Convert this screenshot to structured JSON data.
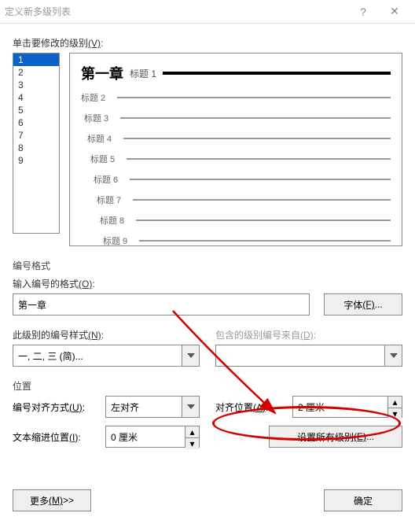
{
  "titlebar": {
    "title": "定义新多级列表",
    "help": "?",
    "close": "✕"
  },
  "labels": {
    "click_level": "单击要修改的级别",
    "click_level_key": "(V)",
    "number_format_section": "编号格式",
    "enter_format": "输入编号的格式",
    "enter_format_key": "(O)",
    "font_btn": "字体",
    "font_btn_key": "(F)",
    "this_level_style": "此级别的编号样式",
    "this_level_style_key": "(N)",
    "include_from": "包含的级别编号来自",
    "include_from_key": "(D)",
    "position_section": "位置",
    "align_mode": "编号对齐方式",
    "align_mode_key": "(U)",
    "align_pos": "对齐位置",
    "align_pos_key": "(A)",
    "indent_pos": "文本缩进位置",
    "indent_pos_key": "(I)",
    "set_all": "设置所有级别",
    "set_all_key": "(E)",
    "more": "更多",
    "more_key": "(M)",
    "more_sfx": " >>",
    "ok": "确定",
    "colon": ":"
  },
  "levels": [
    "1",
    "2",
    "3",
    "4",
    "5",
    "6",
    "7",
    "8",
    "9"
  ],
  "selected_level": 0,
  "preview": {
    "chapter": "第一章",
    "chapter_sub": "标题 1",
    "rows": [
      "标题 2",
      "标题 3",
      "标题 4",
      "标题 5",
      "标题 6",
      "标题 7",
      "标题 8",
      "标题 9"
    ]
  },
  "values": {
    "format_text": "第一章",
    "style_combo": "一, 二, 三 (简)...",
    "include_combo": "",
    "align_combo": "左对齐",
    "align_pos": "2 厘米",
    "indent_pos": "0 厘米"
  }
}
